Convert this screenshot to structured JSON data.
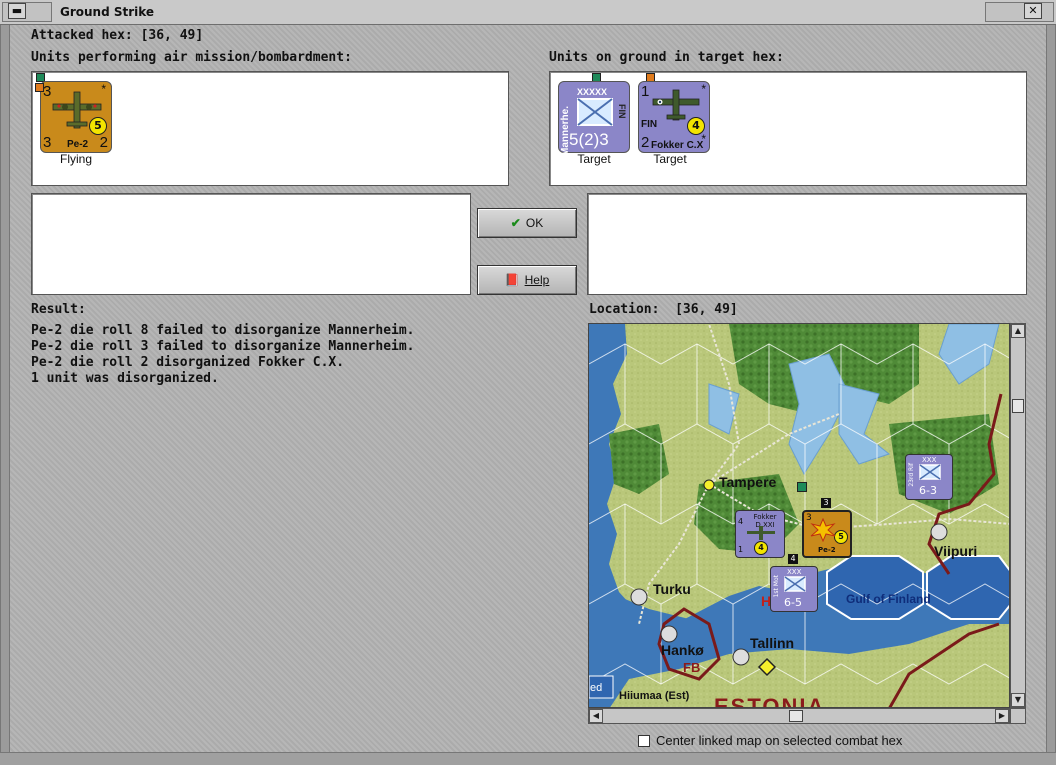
{
  "window": {
    "title": "Ground Strike"
  },
  "attacked_hex": {
    "label": "Attacked hex:",
    "value": "[36, 49]"
  },
  "air_units": {
    "label": "Units performing air mission/bombardment:",
    "items": [
      {
        "name": "Pe-2",
        "top_left": "3",
        "bottom_left": "3",
        "bottom_right": "2",
        "badge": "5",
        "corner": "*",
        "status": "Flying"
      }
    ]
  },
  "ground_units": {
    "label": "Units on ground in target hex:",
    "items": [
      {
        "name": "Mannerhe.",
        "size": "XXXXX",
        "nation": "FIN",
        "strength": "5(2)3",
        "status": "Target"
      },
      {
        "name": "Fokker C.X",
        "top_left": "1",
        "nation": "FIN",
        "bottom_left": "2",
        "badge": "4",
        "corner": "*",
        "status": "Target"
      }
    ]
  },
  "buttons": {
    "ok": "OK",
    "help": "Help"
  },
  "result": {
    "label": "Result:",
    "lines": [
      "Pe-2 die roll 8 failed to disorganize Mannerheim.",
      "Pe-2 die roll 3 failed to disorganize Mannerheim.",
      "Pe-2 die roll 2 disorganized Fokker C.X.",
      "1 unit was disorganized."
    ]
  },
  "location": {
    "label": "Location:",
    "value": "[36, 49]"
  },
  "map": {
    "places": {
      "tampere": "Tampere",
      "turku": "Turku",
      "viipuri": "Viipuri",
      "hanko": "Hankø",
      "fb": "FB",
      "tallinn": "Tallinn",
      "gulf": "Gulf of Finland",
      "hiiumaa": "Hiiumaa (Est)",
      "estonia": "ESTONIA",
      "ed": "ed",
      "h": "H"
    },
    "counters": {
      "fokker_name": "Fokker D.XXI",
      "fokker_badge": "4",
      "fokker_left": "4",
      "fokker_bottom": "1",
      "pe2_name": "Pe-2",
      "pe2_badge": "5",
      "pe2_top": "3",
      "stack_count_1": "3",
      "stack_count_2": "4",
      "army1_size": "XXX",
      "army1_strength": "6-5",
      "army1_name": "1st Mot",
      "army2_size": "XXX",
      "army2_strength": "6-3",
      "army2_name": "23rd Rif"
    }
  },
  "center_linked": {
    "label": "Center linked map on selected combat hex",
    "checked": false
  },
  "colors": {
    "air_counter": "#c98a1b",
    "ground_counter": "#8b86c8",
    "sea": "#3e78b8",
    "land": "#b9c77a",
    "forest": "#4f8a37"
  }
}
